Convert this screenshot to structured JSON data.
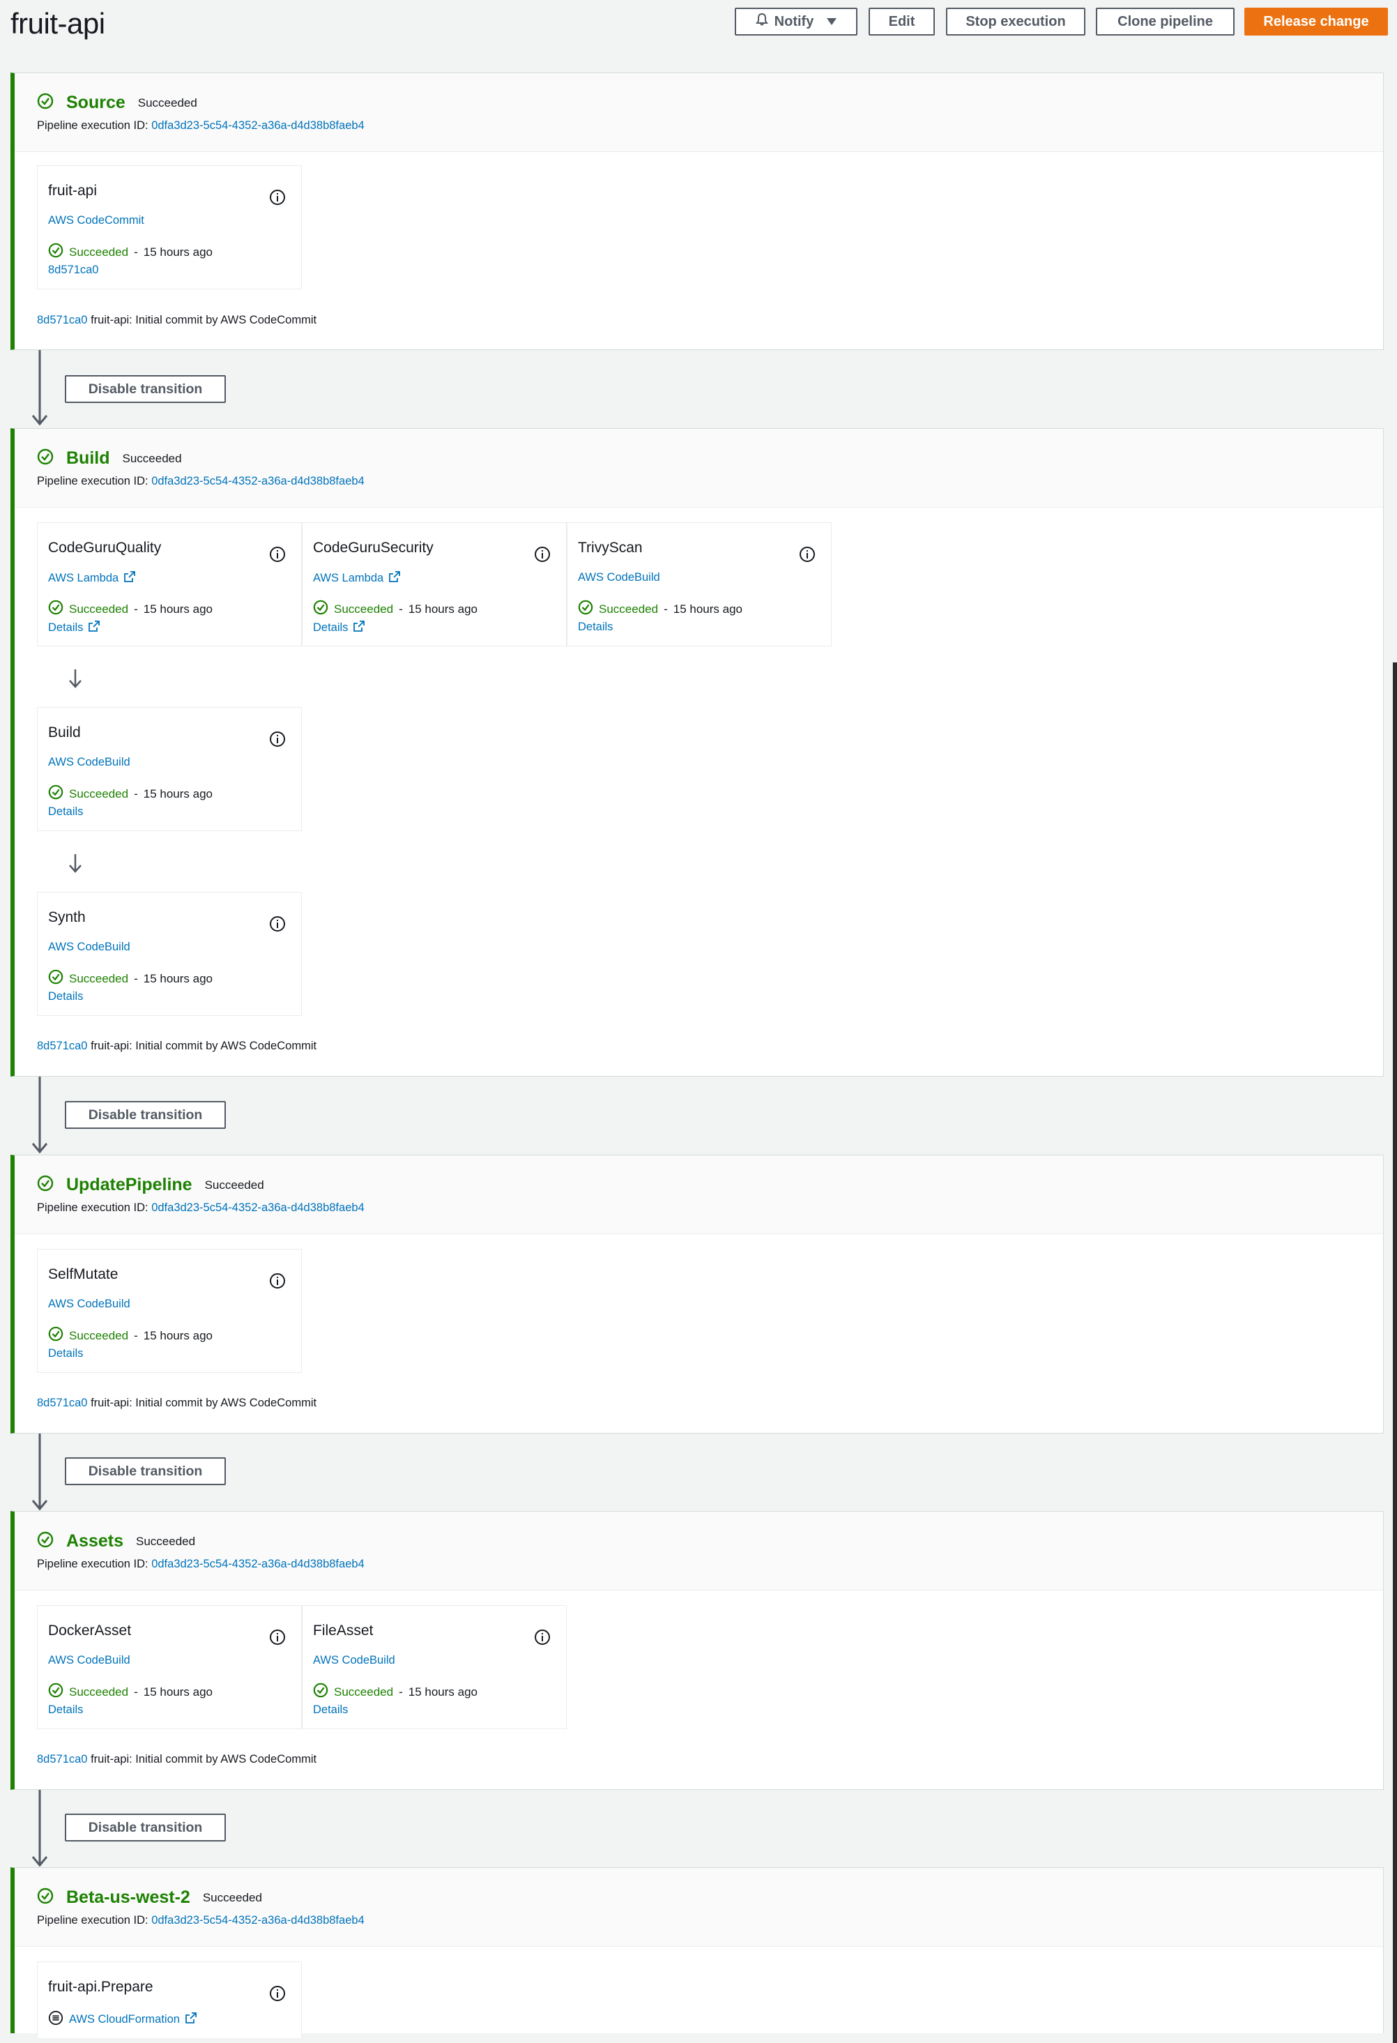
{
  "pipeline": {
    "name": "fruit-api"
  },
  "header_buttons": {
    "notify": "Notify",
    "edit": "Edit",
    "stop": "Stop execution",
    "clone": "Clone pipeline",
    "release": "Release change"
  },
  "labels": {
    "exec_prefix": "Pipeline execution ID:",
    "status_succeeded": "Succeeded",
    "time_ago": "15 hours ago",
    "details": "Details",
    "transition": "Disable transition"
  },
  "execution_id": "0dfa3d23-5c54-4352-a36a-d4d38b8faeb4",
  "commit": {
    "id": "8d571ca0",
    "message": "fruit-api: Initial commit by AWS CodeCommit"
  },
  "stages": [
    {
      "name": "Source",
      "status": "Succeeded",
      "actions": [
        {
          "name": "fruit-api",
          "provider": "AWS CodeCommit",
          "status": "Succeeded",
          "time": "15 hours ago",
          "link": "8d571ca0"
        }
      ]
    },
    {
      "name": "Build",
      "status": "Succeeded",
      "actions": [
        {
          "name": "CodeGuruQuality",
          "provider": "AWS Lambda",
          "status": "Succeeded",
          "time": "15 hours ago",
          "link": "Details"
        },
        {
          "name": "CodeGuruSecurity",
          "provider": "AWS Lambda",
          "status": "Succeeded",
          "time": "15 hours ago",
          "link": "Details"
        },
        {
          "name": "TrivyScan",
          "provider": "AWS CodeBuild",
          "status": "Succeeded",
          "time": "15 hours ago",
          "link": "Details"
        },
        {
          "name": "Build",
          "provider": "AWS CodeBuild",
          "status": "Succeeded",
          "time": "15 hours ago",
          "link": "Details"
        },
        {
          "name": "Synth",
          "provider": "AWS CodeBuild",
          "status": "Succeeded",
          "time": "15 hours ago",
          "link": "Details"
        }
      ]
    },
    {
      "name": "UpdatePipeline",
      "status": "Succeeded",
      "actions": [
        {
          "name": "SelfMutate",
          "provider": "AWS CodeBuild",
          "status": "Succeeded",
          "time": "15 hours ago",
          "link": "Details"
        }
      ]
    },
    {
      "name": "Assets",
      "status": "Succeeded",
      "actions": [
        {
          "name": "DockerAsset",
          "provider": "AWS CodeBuild",
          "status": "Succeeded",
          "time": "15 hours ago",
          "link": "Details"
        },
        {
          "name": "FileAsset",
          "provider": "AWS CodeBuild",
          "status": "Succeeded",
          "time": "15 hours ago",
          "link": "Details"
        }
      ]
    },
    {
      "name": "Beta-us-west-2",
      "status": "Succeeded",
      "actions": [
        {
          "name": "fruit-api.Prepare",
          "provider": "AWS CloudFormation"
        }
      ]
    }
  ],
  "colors": {
    "success": "#1d8102",
    "link": "#0073bb",
    "primary": "#ec7211",
    "border": "#545b64"
  },
  "icons": {
    "check": "check-circle-icon",
    "info": "info-icon",
    "external": "external-link-icon",
    "bell": "bell-icon",
    "caret": "caret-down-icon",
    "arrow": "arrow-down-icon",
    "cfn": "cloudformation-icon"
  }
}
